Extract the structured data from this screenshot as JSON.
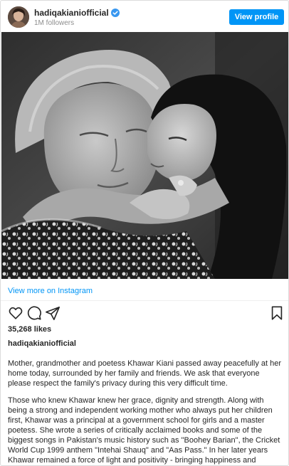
{
  "header": {
    "username": "hadiqakianiofficial",
    "followers": "1M followers",
    "view_profile_label": "View profile"
  },
  "media": {
    "description_icon": "black-and-white-photo"
  },
  "links": {
    "view_more": "View more on Instagram"
  },
  "actions": {
    "icons": [
      "heart-icon",
      "comment-icon",
      "share-icon",
      "bookmark-icon"
    ]
  },
  "post": {
    "likes": "35,268 likes",
    "caption_username": "hadiqakianiofficial",
    "caption_paragraphs": [
      "Mother, grandmother and poetess Khawar Kiani passed away peacefully at her home today, surrounded by her family and friends. We ask that everyone please respect the family's privacy during this very difficult time.",
      "Those who knew Khawar knew her grace, dignity and strength. Along with being a strong and independent working mother who always put her children first, Khawar was a principal at a government school for girls and a master poetess. She wrote a series of critically acclaimed books and some of the biggest songs in Pakistan's music history such as \"Boohey Barian\", the Cricket World Cup 1999 anthem \"Intehai Shauq\" and \"Aas Pass.\" In her later years Khawar remained a force of light and positivity - bringing happiness and inspiration to all those around her."
    ]
  },
  "colors": {
    "accent": "#0095f6",
    "text": "#262626",
    "muted": "#8e8e8e",
    "border": "#dbdbdb"
  }
}
